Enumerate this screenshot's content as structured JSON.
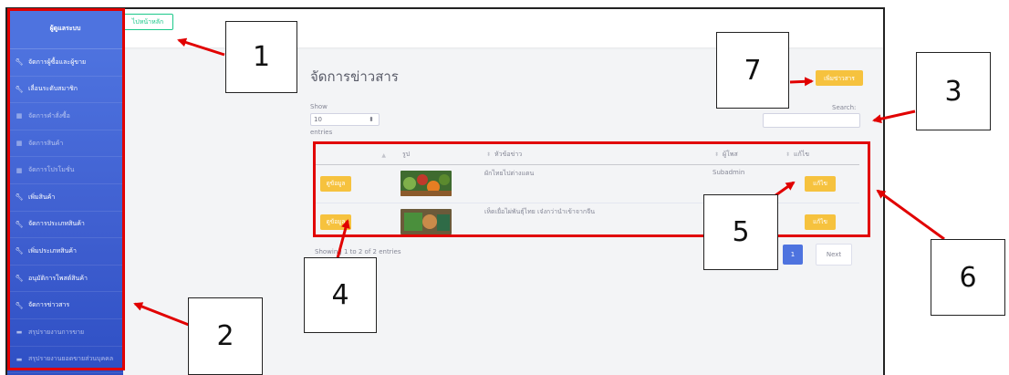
{
  "sidebar": {
    "brand": "ผู้ดูแลระบบ",
    "items": [
      {
        "label": "จัดการผู้ซื้อและผู้ขาย",
        "icon": "wrench-icon",
        "dim": false
      },
      {
        "label": "เลื่อนระดับสมาชิก",
        "icon": "wrench-icon",
        "dim": false
      },
      {
        "label": "จัดการคำสั่งซื้อ",
        "icon": "table-icon",
        "dim": true
      },
      {
        "label": "จัดการสินค้า",
        "icon": "table-icon",
        "dim": true
      },
      {
        "label": "จัดการโปรโมชั่น",
        "icon": "table-icon",
        "dim": true
      },
      {
        "label": "เพิ่มสินค้า",
        "icon": "wrench-icon",
        "dim": false
      },
      {
        "label": "จัดการประเภทสินค้า",
        "icon": "wrench-icon",
        "dim": false
      },
      {
        "label": "เพิ่มประเภทสินค้า",
        "icon": "wrench-icon",
        "dim": false
      },
      {
        "label": "อนุมัติการโพสต์สินค้า",
        "icon": "wrench-icon",
        "dim": false
      },
      {
        "label": "จัดการข่าวสาร",
        "icon": "wrench-icon",
        "dim": false
      },
      {
        "label": "สรุปรายงานการขาย",
        "icon": "folder-icon",
        "dim": true
      },
      {
        "label": "สรุปรายงานยอดขายส่วนบุคคล",
        "icon": "folder-icon",
        "dim": true
      }
    ]
  },
  "header": {
    "home_button": "ไปหน้าหลัก"
  },
  "main": {
    "title": "จัดการข่าวสาร",
    "add_button": "เพิ่มข่าวสาร",
    "show_label": "Show",
    "entries_select": "10",
    "entries_label": "entries",
    "search_label": "Search:",
    "columns": [
      "",
      "รูป",
      "หัวข้อข่าว",
      "ผู้โพส",
      "แก้ไข"
    ],
    "rows": [
      {
        "detail_button": "ดูข้อมูล",
        "title": "ผักไทยไปต่างแดน",
        "poster": "Subadmin",
        "edit_button": "แก้ไข"
      },
      {
        "detail_button": "ดูข้อมูล",
        "title": "เห็ดเยื่อไผ่พันธุ์ไทย เจ๋งกว่านำเข้าจากจีน",
        "poster": "",
        "edit_button": "แก้ไข"
      }
    ],
    "info": "Showing 1 to 2 of 2 entries",
    "current_page": "1",
    "next_button": "Next"
  },
  "callouts": [
    "1",
    "2",
    "3",
    "4",
    "5",
    "6",
    "7"
  ],
  "colors": {
    "primary": "#4e73df",
    "warning": "#f6c23e",
    "success": "#1cc88a",
    "annotation": "#e10000"
  }
}
